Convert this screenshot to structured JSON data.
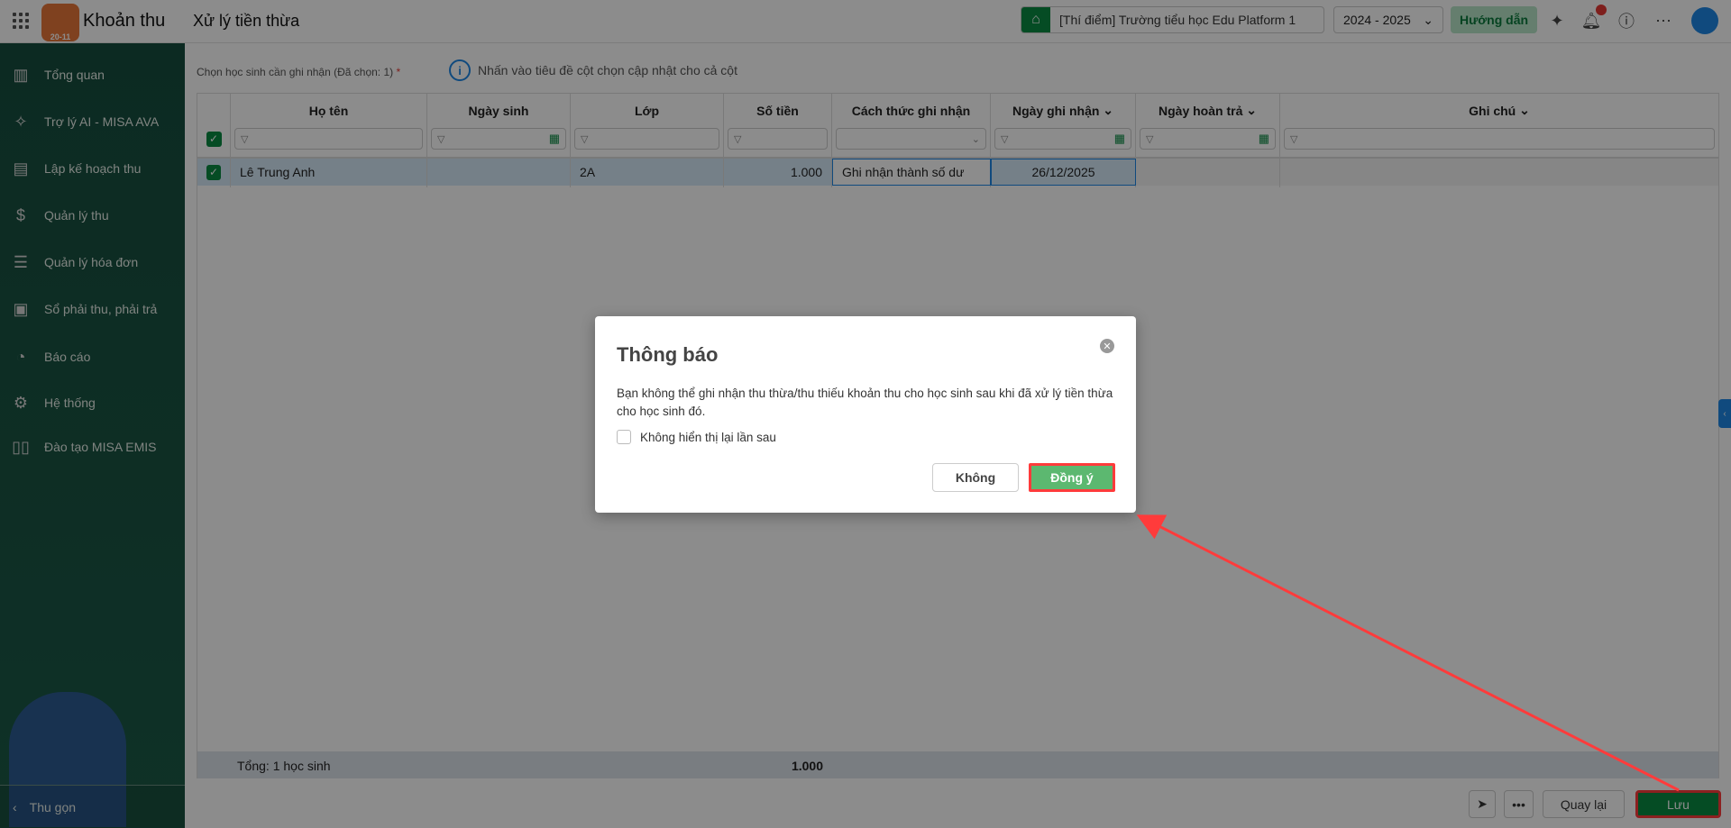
{
  "header": {
    "app_title": "Khoản thu",
    "logo_text": "20-11",
    "page_title": "Xử lý tiền thừa",
    "school": "[Thí điểm] Trường tiểu học Edu Platform 1",
    "year": "2024 - 2025",
    "guide": "Hướng dẫn"
  },
  "sidebar": {
    "items": [
      {
        "label": "Tổng quan",
        "icon": "chart-icon"
      },
      {
        "label": "Trợ lý AI - MISA AVA",
        "icon": "sparkle-icon"
      },
      {
        "label": "Lập kế hoạch thu",
        "icon": "calendar-dollar-icon"
      },
      {
        "label": "Quản lý thu",
        "icon": "hand-coin-icon"
      },
      {
        "label": "Quản lý hóa đơn",
        "icon": "document-icon"
      },
      {
        "label": "Sổ phải thu, phải trả",
        "icon": "ledger-icon"
      },
      {
        "label": "Báo cáo",
        "icon": "pie-chart-icon"
      },
      {
        "label": "Hệ thống",
        "icon": "gear-icon"
      },
      {
        "label": "Đào tạo MISA EMIS",
        "icon": "book-icon"
      }
    ],
    "collapse": "Thu gọn"
  },
  "main": {
    "select_label": "Chọn học sinh cần ghi nhận (Đã chọn: 1)",
    "required": "*",
    "info": "Nhấn vào tiêu đề cột chọn cập nhật cho cả cột",
    "columns": [
      "Họ tên",
      "Ngày sinh",
      "Lớp",
      "Số tiền",
      "Cách thức ghi nhận",
      "Ngày ghi nhận",
      "Ngày hoàn trả",
      "Ghi chú"
    ],
    "rows": [
      {
        "name": "Lê Trung Anh",
        "dob": "",
        "class": "2A",
        "amount": "1.000",
        "method": "Ghi nhận thành số dư",
        "record_date": "26/12/2025",
        "refund_date": "",
        "note": ""
      }
    ],
    "total_label": "Tổng: 1 học sinh",
    "total_amount": "1.000"
  },
  "footer": {
    "back": "Quay lại",
    "save": "Lưu"
  },
  "dialog": {
    "title": "Thông báo",
    "message": "Bạn không thể ghi nhận thu thừa/thu thiếu khoản thu cho học sinh sau khi đã xử lý tiền thừa cho học sinh đó.",
    "dont_show": "Không hiển thị lại lần sau",
    "no": "Không",
    "yes": "Đồng ý"
  },
  "colors": {
    "brand": "#0a8a43",
    "highlight": "#ff3b3b"
  }
}
